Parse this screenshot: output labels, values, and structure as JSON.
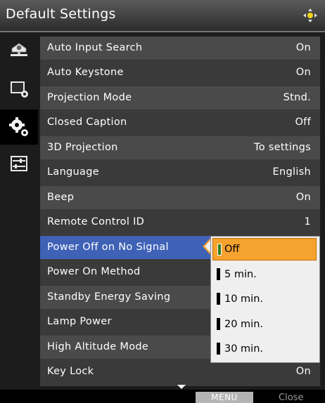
{
  "window": {
    "title": "Default Settings"
  },
  "sidebar": {
    "items": [
      {
        "icon": "projector-icon",
        "active": false
      },
      {
        "icon": "display-settings-icon",
        "active": false
      },
      {
        "icon": "gears-icon",
        "active": true
      },
      {
        "icon": "sliders-icon",
        "active": false
      }
    ]
  },
  "settings": {
    "rows": [
      {
        "label": "Auto Input Search",
        "value": "On"
      },
      {
        "label": "Auto Keystone",
        "value": "On"
      },
      {
        "label": "Projection Mode",
        "value": "Stnd."
      },
      {
        "label": "Closed Caption",
        "value": "Off"
      },
      {
        "label": "3D Projection",
        "value": "To settings"
      },
      {
        "label": "Language",
        "value": "English"
      },
      {
        "label": "Beep",
        "value": "On"
      },
      {
        "label": "Remote Control ID",
        "value": "1"
      },
      {
        "label": "Power Off on No Signal",
        "value": ""
      },
      {
        "label": "Power On Method",
        "value": ""
      },
      {
        "label": "Standby Energy Saving",
        "value": ""
      },
      {
        "label": "Lamp Power",
        "value": ""
      },
      {
        "label": "High Altitude Mode",
        "value": ""
      },
      {
        "label": "Key Lock",
        "value": "On"
      }
    ]
  },
  "popup": {
    "options": [
      "Off",
      "5 min.",
      "10 min.",
      "20 min.",
      "30 min."
    ],
    "selected": "Off"
  },
  "footer": {
    "menu_label": "MENU",
    "close_label": "Close"
  },
  "colors": {
    "selected_row": "#3f62b7",
    "selected_option": "#f6a22f",
    "selected_option_marker": "#2e7d1d"
  }
}
